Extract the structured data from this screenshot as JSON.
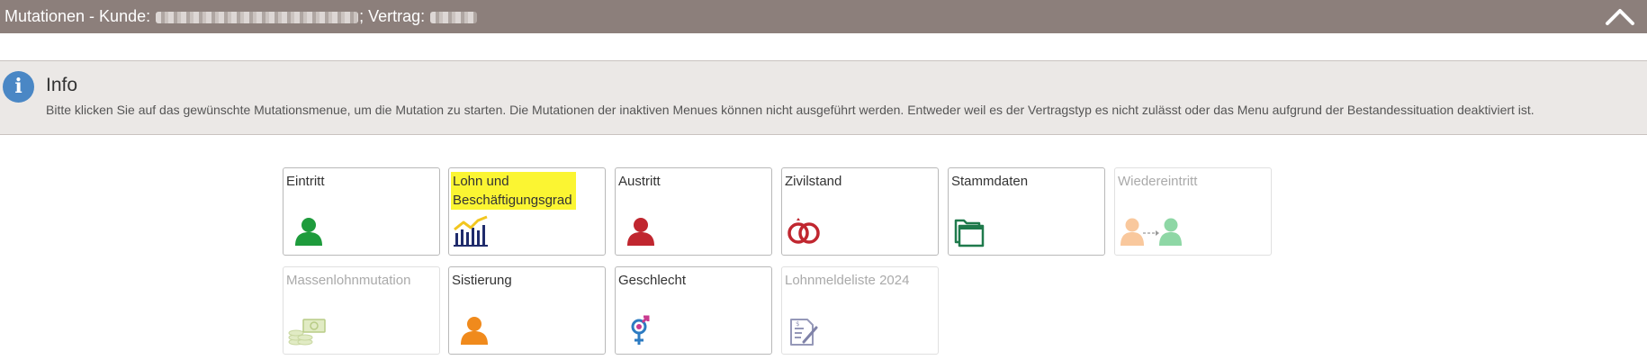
{
  "header": {
    "title_prefix": "Mutationen - Kunde:",
    "contract_label": "; Vertrag:",
    "collapse_icon": "chevron-up-icon"
  },
  "info": {
    "icon": "info-icon",
    "icon_glyph": "i",
    "title": "Info",
    "text": "Bitte klicken Sie auf das gewünschte Mutationsmenue, um die Mutation zu starten. Die Mutationen der inaktiven Menues können nicht ausgeführt werden. Entweder weil es der Vertragstyp es nicht zulässt oder das Menu aufgrund der Bestandessituation deaktiviert ist."
  },
  "tiles": [
    {
      "label": "Eintritt",
      "icon": "person-icon",
      "color": "#1e9b3c",
      "enabled": true,
      "highlighted": false
    },
    {
      "label": "Lohn und Beschäftigungsgrad",
      "icon": "salary-chart-icon",
      "color": "#1f2b6b",
      "enabled": true,
      "highlighted": true
    },
    {
      "label": "Austritt",
      "icon": "person-icon",
      "color": "#c0262f",
      "enabled": true,
      "highlighted": false
    },
    {
      "label": "Zivilstand",
      "icon": "wedding-rings-icon",
      "color": "#c0262f",
      "enabled": true,
      "highlighted": false
    },
    {
      "label": "Stammdaten",
      "icon": "folder-icon",
      "color": "#1f7a4c",
      "enabled": true,
      "highlighted": false
    },
    {
      "label": "Wiedereintritt",
      "icon": "re-entry-icon",
      "color": "#f4a460",
      "enabled": false,
      "highlighted": false
    },
    {
      "label": "Massenlohnmutation",
      "icon": "money-stack-icon",
      "color": "#cfe0a2",
      "enabled": false,
      "highlighted": false
    },
    {
      "label": "Sistierung",
      "icon": "person-icon",
      "color": "#f08a1c",
      "enabled": true,
      "highlighted": false
    },
    {
      "label": "Geschlecht",
      "icon": "gender-icon",
      "color": "#c93a8f",
      "enabled": true,
      "highlighted": false
    },
    {
      "label": "Lohnmeldeliste 2024",
      "icon": "document-pen-icon",
      "color": "#7f82a8",
      "enabled": false,
      "highlighted": false
    }
  ]
}
